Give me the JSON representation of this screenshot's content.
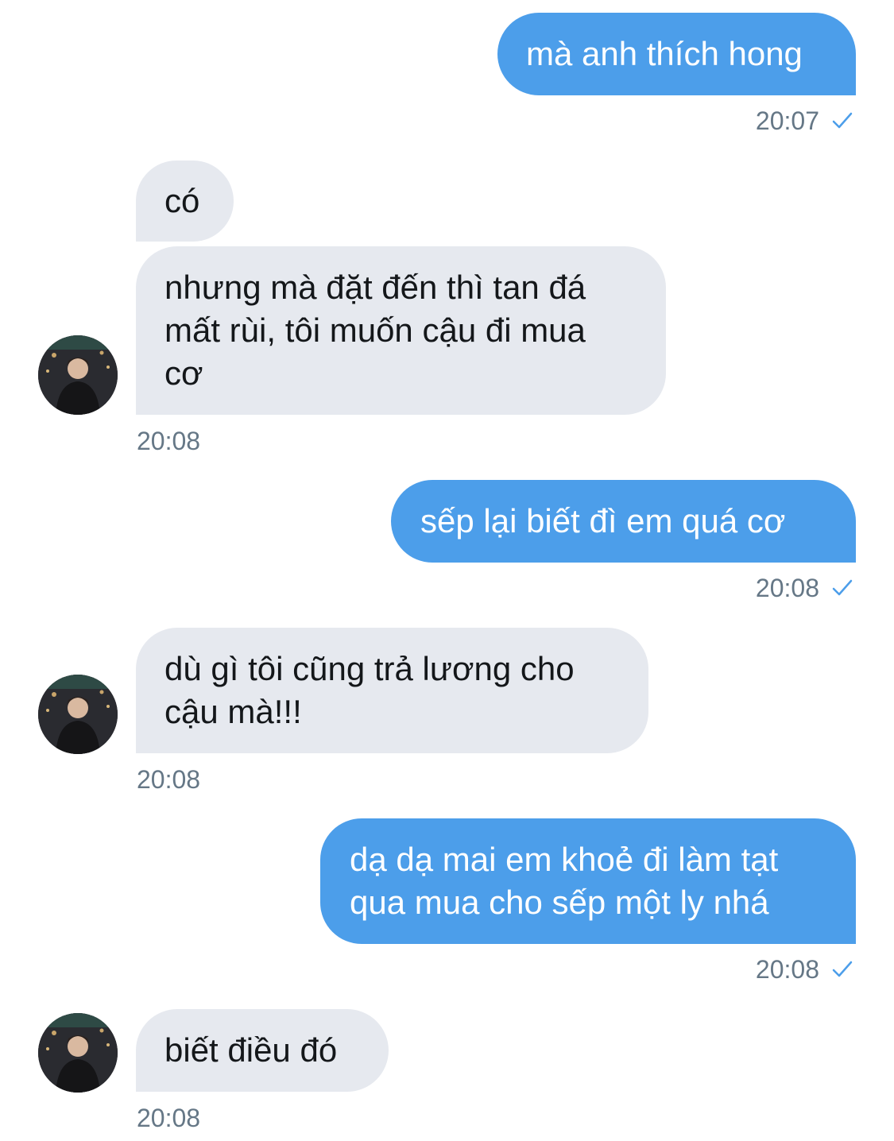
{
  "colors": {
    "outgoing_bubble": "#4c9eea",
    "incoming_bubble": "#e6e9ef",
    "timestamp": "#657786",
    "read_check": "#4c9eea"
  },
  "messages": [
    {
      "direction": "outgoing",
      "text": "mà anh thích hong",
      "time": "20:07",
      "status_icon": "check-icon"
    },
    {
      "direction": "incoming",
      "text": "có"
    },
    {
      "direction": "incoming",
      "text": "nhưng mà đặt đến thì tan đá\nmất rùi, tôi muốn cậu đi mua\ncơ",
      "time": "20:08",
      "avatar": "avatar"
    },
    {
      "direction": "outgoing",
      "text": "sếp lại biết đì em quá cơ",
      "time": "20:08",
      "status_icon": "check-icon"
    },
    {
      "direction": "incoming",
      "text": "dù gì tôi cũng trả lương cho\ncậu mà!!!",
      "time": "20:08",
      "avatar": "avatar"
    },
    {
      "direction": "outgoing",
      "text": "dạ dạ mai em khoẻ đi làm tạt\nqua mua cho sếp một ly nhá",
      "time": "20:08",
      "status_icon": "check-icon"
    },
    {
      "direction": "incoming",
      "text": "biết điều đó",
      "time": "20:08",
      "avatar": "avatar"
    }
  ]
}
